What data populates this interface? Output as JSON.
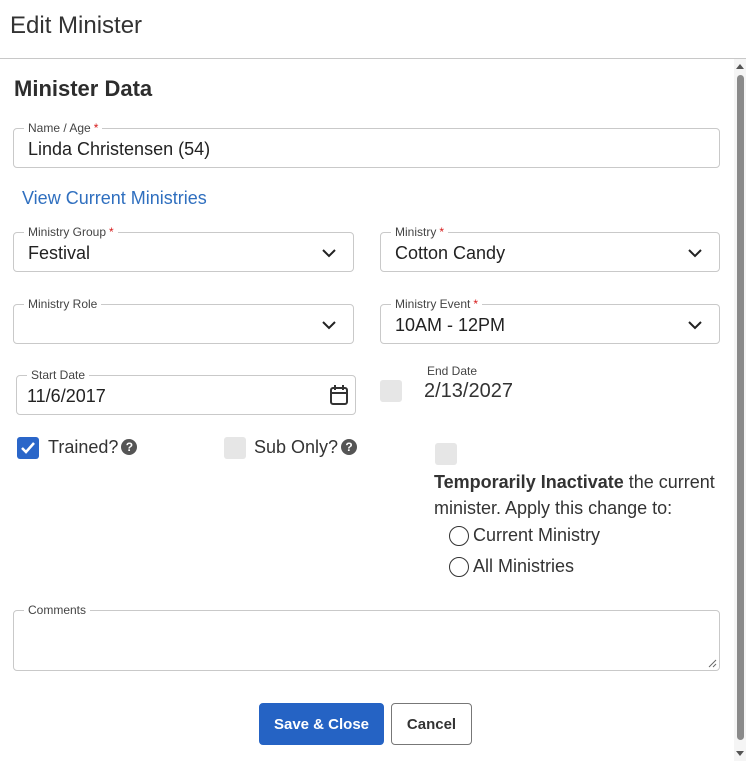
{
  "dialog": {
    "title": "Edit Minister"
  },
  "section": {
    "title": "Minister Data"
  },
  "name_age": {
    "label": "Name / Age",
    "required_mark": "*",
    "value": "Linda Christensen (54)"
  },
  "view_link": {
    "label": "View Current Ministries"
  },
  "ministry_group": {
    "label": "Ministry Group",
    "required_mark": "*",
    "value": "Festival"
  },
  "ministry": {
    "label": "Ministry",
    "required_mark": "*",
    "value": "Cotton Candy"
  },
  "ministry_role": {
    "label": "Ministry Role",
    "value": ""
  },
  "ministry_event": {
    "label": "Ministry Event",
    "required_mark": "*",
    "value": "10AM - 12PM"
  },
  "start_date": {
    "label": "Start Date",
    "value": "11/6/2017"
  },
  "end_date": {
    "label": "End Date",
    "value": "2/13/2027",
    "checked": false
  },
  "trained": {
    "label": "Trained?",
    "checked": true
  },
  "sub_only": {
    "label": "Sub Only?",
    "checked": false
  },
  "inactivate": {
    "checked": false,
    "bold_text": "Temporarily Inactivate",
    "rest_text": " the current minister. Apply this change to:",
    "options": [
      "Current Ministry",
      "All Ministries"
    ]
  },
  "comments": {
    "label": "Comments",
    "value": ""
  },
  "buttons": {
    "save_label": "Save & Close",
    "cancel_label": "Cancel"
  },
  "colors": {
    "primary": "#2563c4",
    "link": "#2f6fbf",
    "required": "#d61a1a",
    "checkbox_checked": "#2a66c9"
  }
}
